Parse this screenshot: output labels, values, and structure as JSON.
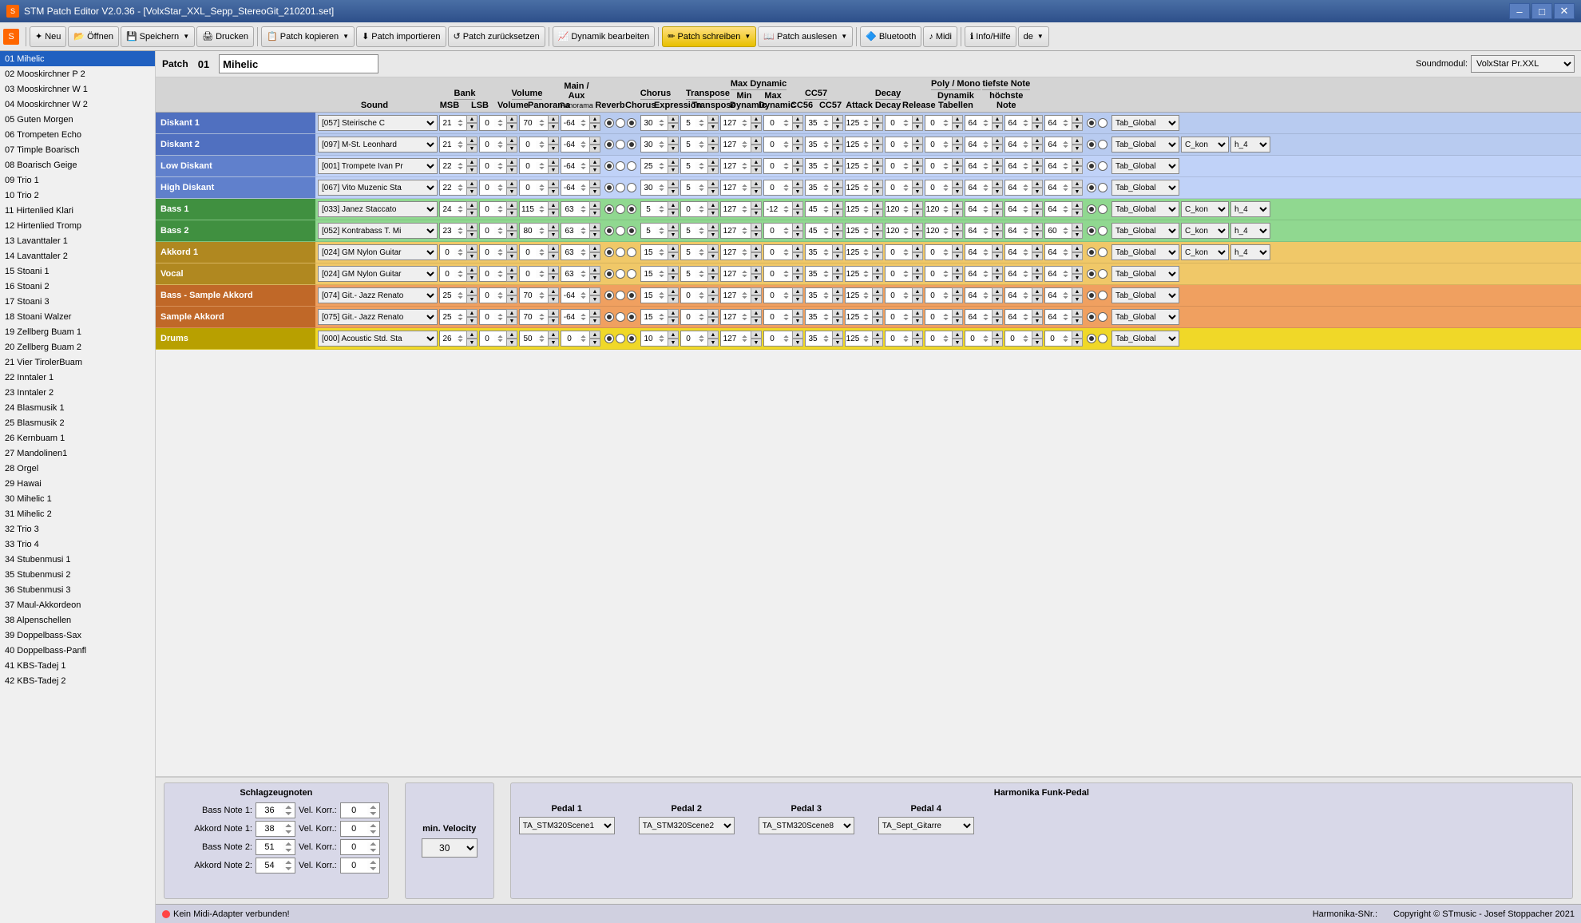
{
  "titlebar": {
    "title": "STM Patch Editor V2.0.36 - [VolxStar_XXL_Sepp_StereoGit_210201.set]",
    "icon": "S"
  },
  "toolbar": {
    "buttons": [
      {
        "id": "logo",
        "icon": "S",
        "label": ""
      },
      {
        "id": "new",
        "icon": "✦",
        "label": "Neu"
      },
      {
        "id": "open",
        "icon": "📂",
        "label": "Öffnen"
      },
      {
        "id": "save",
        "icon": "💾",
        "label": "Speichern"
      },
      {
        "id": "print",
        "icon": "🖨",
        "label": "Drucken"
      },
      {
        "id": "copy",
        "icon": "📋",
        "label": "Patch kopieren"
      },
      {
        "id": "import",
        "icon": "⬇",
        "label": "Patch importieren"
      },
      {
        "id": "reset",
        "icon": "↺",
        "label": "Patch zurücksetzen"
      },
      {
        "id": "dynamics",
        "icon": "📈",
        "label": "Dynamik bearbeiten"
      },
      {
        "id": "write",
        "icon": "✏",
        "label": "Patch schreiben"
      },
      {
        "id": "read",
        "icon": "📖",
        "label": "Patch auslesen"
      },
      {
        "id": "bluetooth",
        "icon": "🔷",
        "label": "Bluetooth"
      },
      {
        "id": "midi",
        "icon": "♪",
        "label": "Midi"
      },
      {
        "id": "help",
        "icon": "?",
        "label": "Info/Hilfe"
      },
      {
        "id": "lang",
        "icon": "",
        "label": "de"
      }
    ]
  },
  "sidebar": {
    "items": [
      "01 Mihelic",
      "02 Mooskirchner P 2",
      "03 Mooskirchner W 1",
      "04 Mooskirchner W 2",
      "05 Guten Morgen",
      "06 Trompeten Echo",
      "07 Timple Boarisch",
      "08 Boarisch Geige",
      "09 Trio 1",
      "10 Trio 2",
      "11 Hirtenlied Klari",
      "12 Hirtenlied Tromp",
      "13 Lavanttaler 1",
      "14 Lavanttaler 2",
      "15 Stoani 1",
      "16 Stoani 2",
      "17 Stoani 3",
      "18 Stoani Walzer",
      "19 Zellberg Buam 1",
      "20 Zellberg Buam 2",
      "21 Vier TirolerBuam",
      "22 Inntaler 1",
      "23 Inntaler 2",
      "24 Blasmusik 1",
      "25 Blasmusik 2",
      "26 Kernbuam 1",
      "27 Mandolinen1",
      "28 Orgel",
      "29 Hawai",
      "30 Mihelic 1",
      "31 Mihelic 2",
      "32 Trio 3",
      "33 Trio 4",
      "34 Stubenmusi 1",
      "35 Stubenmusi 2",
      "36 Stubenmusi 3",
      "37 Maul-Akkordeon",
      "38 Alpenschellen",
      "39 Doppelbass-Sax",
      "40 Doppelbass-Panfl",
      "41 KBS-Tadej 1",
      "42 KBS-Tadej 2"
    ],
    "selected_index": 0
  },
  "patch": {
    "label": "Patch",
    "number": "01",
    "name": "Mihelic",
    "soundmodule_label": "Soundmodul:",
    "soundmodule_value": "VolxStar Pr.XXL"
  },
  "columns": {
    "sound": "Sound",
    "bank_msb": "MSB",
    "bank_lsb": "LSB",
    "volume": "Volume",
    "panorama": "Panorama",
    "reverb": "Reverb",
    "chorus": "Chorus",
    "expression": "Expression",
    "transpose": "Transpose",
    "min_dynamic": "Min Dynamic",
    "max_dynamic": "Max Dynamic",
    "cc56": "CC56",
    "cc57": "CC57",
    "attack": "Attack",
    "decay": "Decay",
    "release": "Release",
    "poly_mono": "Poly / Mono",
    "dyn_tab": "Dynamik Tabellen",
    "low_note": "tiefste Note",
    "high_note": "höchste Note"
  },
  "tracks": [
    {
      "id": "diskant1",
      "label": "Diskant 1",
      "color": "diskant1",
      "sound": "[057] Steirische C",
      "msb": "21",
      "lsb": "0",
      "volume": "70",
      "pan": "-64",
      "r1": true,
      "r2": false,
      "r3": true,
      "reverb": "30",
      "chorus": "5",
      "expression": "127",
      "transpose": "0",
      "min_dyn": "35",
      "max_dyn": "125",
      "cc56": "0",
      "cc57": "0",
      "attack": "64",
      "decay": "64",
      "release": "64",
      "p1": true,
      "p2": false,
      "tab": "Tab_Global",
      "low": "",
      "high": ""
    },
    {
      "id": "diskant2",
      "label": "Diskant 2",
      "color": "diskant2",
      "sound": "[097] M-St. Leonhard",
      "msb": "21",
      "lsb": "0",
      "volume": "0",
      "pan": "-64",
      "r1": true,
      "r2": false,
      "r3": true,
      "reverb": "30",
      "chorus": "5",
      "expression": "127",
      "transpose": "0",
      "min_dyn": "35",
      "max_dyn": "125",
      "cc56": "0",
      "cc57": "0",
      "attack": "64",
      "decay": "64",
      "release": "64",
      "p1": true,
      "p2": false,
      "tab": "Tab_Global",
      "low": "C_kon",
      "high": "h_4"
    },
    {
      "id": "low-diskant",
      "label": "Low Diskant",
      "color": "low-diskant",
      "sound": "[001] Trompete Ivan Pr",
      "msb": "22",
      "lsb": "0",
      "volume": "0",
      "pan": "-64",
      "r1": true,
      "r2": false,
      "r3": false,
      "reverb": "25",
      "chorus": "5",
      "expression": "127",
      "transpose": "0",
      "min_dyn": "35",
      "max_dyn": "125",
      "cc56": "0",
      "cc57": "0",
      "attack": "64",
      "decay": "64",
      "release": "64",
      "p1": true,
      "p2": false,
      "tab": "Tab_Global",
      "low": "",
      "high": ""
    },
    {
      "id": "high-diskant",
      "label": "High Diskant",
      "color": "high-diskant",
      "sound": "[067] Vito Muzenic Sta",
      "msb": "22",
      "lsb": "0",
      "volume": "0",
      "pan": "-64",
      "r1": true,
      "r2": false,
      "r3": false,
      "reverb": "30",
      "chorus": "5",
      "expression": "127",
      "transpose": "0",
      "min_dyn": "35",
      "max_dyn": "125",
      "cc56": "0",
      "cc57": "0",
      "attack": "64",
      "decay": "64",
      "release": "64",
      "p1": true,
      "p2": false,
      "tab": "Tab_Global",
      "low": "",
      "high": ""
    },
    {
      "id": "bass1",
      "label": "Bass 1",
      "color": "bass1",
      "sound": "[033] Janez Staccato",
      "msb": "24",
      "lsb": "0",
      "volume": "115",
      "pan": "63",
      "r1": true,
      "r2": false,
      "r3": true,
      "reverb": "5",
      "chorus": "0",
      "expression": "127",
      "transpose": "-12",
      "min_dyn": "45",
      "max_dyn": "125",
      "cc56": "120",
      "cc57": "120",
      "attack": "64",
      "decay": "64",
      "release": "64",
      "p1": true,
      "p2": false,
      "tab": "Tab_Global",
      "low": "C_kon",
      "high": "h_4"
    },
    {
      "id": "bass2",
      "label": "Bass 2",
      "color": "bass2",
      "sound": "[052] Kontrabass T. Mi",
      "msb": "23",
      "lsb": "0",
      "volume": "80",
      "pan": "63",
      "r1": true,
      "r2": false,
      "r3": true,
      "reverb": "5",
      "chorus": "5",
      "expression": "127",
      "transpose": "0",
      "min_dyn": "45",
      "max_dyn": "125",
      "cc56": "120",
      "cc57": "120",
      "attack": "64",
      "decay": "64",
      "release": "60",
      "p1": true,
      "p2": false,
      "tab": "Tab_Global",
      "low": "C_kon",
      "high": "h_4"
    },
    {
      "id": "akkord1",
      "label": "Akkord 1",
      "color": "akkord1",
      "sound": "[024] GM Nylon Guitar",
      "msb": "0",
      "lsb": "0",
      "volume": "0",
      "pan": "63",
      "r1": true,
      "r2": false,
      "r3": false,
      "reverb": "15",
      "chorus": "5",
      "expression": "127",
      "transpose": "0",
      "min_dyn": "35",
      "max_dyn": "125",
      "cc56": "0",
      "cc57": "0",
      "attack": "64",
      "decay": "64",
      "release": "64",
      "p1": true,
      "p2": false,
      "tab": "Tab_Global",
      "low": "C_kon",
      "high": "h_4"
    },
    {
      "id": "vocal",
      "label": "Vocal",
      "color": "vocal",
      "sound": "[024] GM Nylon Guitar",
      "msb": "0",
      "lsb": "0",
      "volume": "0",
      "pan": "63",
      "r1": true,
      "r2": false,
      "r3": false,
      "reverb": "15",
      "chorus": "5",
      "expression": "127",
      "transpose": "0",
      "min_dyn": "35",
      "max_dyn": "125",
      "cc56": "0",
      "cc57": "0",
      "attack": "64",
      "decay": "64",
      "release": "64",
      "p1": true,
      "p2": false,
      "tab": "Tab_Global",
      "low": "",
      "high": ""
    },
    {
      "id": "bass-sample",
      "label": "Bass - Sample Akkord",
      "color": "bass-sample",
      "sound": "[074] Git.- Jazz Renato",
      "msb": "25",
      "lsb": "0",
      "volume": "70",
      "pan": "-64",
      "r1": true,
      "r2": false,
      "r3": true,
      "reverb": "15",
      "chorus": "0",
      "expression": "127",
      "transpose": "0",
      "min_dyn": "35",
      "max_dyn": "125",
      "cc56": "0",
      "cc57": "0",
      "attack": "64",
      "decay": "64",
      "release": "64",
      "p1": true,
      "p2": false,
      "tab": "Tab_Global",
      "low": "",
      "high": ""
    },
    {
      "id": "sample-akkord",
      "label": "Sample Akkord",
      "color": "sample-akkord",
      "sound": "[075] Git.- Jazz Renato",
      "msb": "25",
      "lsb": "0",
      "volume": "70",
      "pan": "-64",
      "r1": true,
      "r2": false,
      "r3": true,
      "reverb": "15",
      "chorus": "0",
      "expression": "127",
      "transpose": "0",
      "min_dyn": "35",
      "max_dyn": "125",
      "cc56": "0",
      "cc57": "0",
      "attack": "64",
      "decay": "64",
      "release": "64",
      "p1": true,
      "p2": false,
      "tab": "Tab_Global",
      "low": "",
      "high": ""
    },
    {
      "id": "drums",
      "label": "Drums",
      "color": "drums",
      "sound": "[000] Acoustic Std. Sta",
      "msb": "26",
      "lsb": "0",
      "volume": "50",
      "pan": "0",
      "r1": true,
      "r2": false,
      "r3": true,
      "reverb": "10",
      "chorus": "0",
      "expression": "127",
      "transpose": "0",
      "min_dyn": "35",
      "max_dyn": "125",
      "cc56": "0",
      "cc57": "0",
      "attack": "0",
      "decay": "0",
      "release": "0",
      "p1": true,
      "p2": false,
      "tab": "Tab_Global",
      "low": "",
      "high": ""
    }
  ],
  "bottom": {
    "schlagzeug_title": "Schlagzeugnoten",
    "bass_note1_label": "Bass Note 1:",
    "bass_note1_val": "36",
    "akkord_note1_label": "Akkord Note 1:",
    "akkord_note1_val": "38",
    "bass_note2_label": "Bass Note 2:",
    "bass_note2_val": "51",
    "akkord_note2_label": "Akkord Note 2:",
    "akkord_note2_val": "54",
    "vel_korr_label": "Vel. Korr.:",
    "vel_korr_vals": [
      "0",
      "0",
      "0",
      "0"
    ],
    "min_vel_title": "min. Velocity",
    "min_vel_val": "30",
    "harm_title": "Harmonika Funk-Pedal",
    "pedal1_label": "Pedal 1",
    "pedal1_val": "TA_STM320Scene1",
    "pedal2_label": "Pedal 2",
    "pedal2_val": "TA_STM320Scene2",
    "pedal3_label": "Pedal 3",
    "pedal3_val": "TA_STM320Scene8",
    "pedal4_label": "Pedal 4",
    "pedal4_val": "TA_Sept_Gitarre"
  },
  "statusbar": {
    "midi_status": "Kein Midi-Adapter verbunden!",
    "harm_nr_label": "Harmonika-SNr.:",
    "harm_nr_val": "",
    "copyright": "Copyright © STmusic - Josef Stoppacher 2021"
  }
}
